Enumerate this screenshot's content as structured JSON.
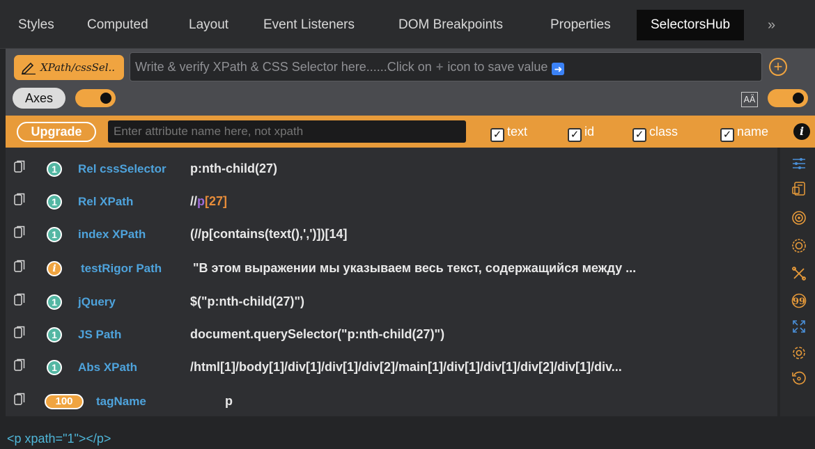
{
  "tabs": [
    {
      "label": "Styles",
      "active": false
    },
    {
      "label": "Computed",
      "active": false
    },
    {
      "label": "Layout",
      "active": false
    },
    {
      "label": "Event Listeners",
      "active": false
    },
    {
      "label": "DOM Breakpoints",
      "active": false
    },
    {
      "label": "Properties",
      "active": false
    },
    {
      "label": "SelectorsHub",
      "active": true
    }
  ],
  "tab_more": "»",
  "toolbar": {
    "xpath_button_label": "XPath/cssSel..",
    "selector_placeholder_before": "Write & verify XPath & CSS Selector here......Click on",
    "selector_placeholder_after": "icon to save value",
    "plus_glyph": "+",
    "add_glyph": "+",
    "axes_label": "Axes",
    "axes_toggle_on": true,
    "font_icon_text": "AÄ",
    "right_toggle_on": true
  },
  "attributes": {
    "upgrade_label": "Upgrade",
    "input_placeholder": "Enter attribute name here, not xpath",
    "checkboxes": [
      {
        "label": "text",
        "checked": true
      },
      {
        "label": "id",
        "checked": true
      },
      {
        "label": "class",
        "checked": true
      },
      {
        "label": "name",
        "checked": true
      }
    ],
    "check_glyph": "✓",
    "info_glyph": "i"
  },
  "results": [
    {
      "badge": "1",
      "badge_type": "count",
      "label": "Rel cssSelector",
      "value": "p:nth-child(27)"
    },
    {
      "badge": "1",
      "badge_type": "count",
      "label": "Rel XPath",
      "value_parts": [
        "//",
        "p",
        "[27]"
      ]
    },
    {
      "badge": "1",
      "badge_type": "count",
      "label": "index XPath",
      "value": "(//p[contains(text(),',')])[14]"
    },
    {
      "badge": "i",
      "badge_type": "info",
      "label": "testRigor Path",
      "value": "\"В этом выражении мы указываем весь текст, содержащийся между ..."
    },
    {
      "badge": "1",
      "badge_type": "count",
      "label": "jQuery",
      "value": "$(\"p:nth-child(27)\")"
    },
    {
      "badge": "1",
      "badge_type": "count",
      "label": "JS Path",
      "value": "document.querySelector(\"p:nth-child(27)\")"
    },
    {
      "badge": "1",
      "badge_type": "count",
      "label": "Abs XPath",
      "value": "/html[1]/body[1]/div[1]/div[1]/div[2]/main[1]/div[1]/div[1]/div[2]/div[1]/div..."
    },
    {
      "badge": "100",
      "badge_type": "count-wide",
      "label": "tagName",
      "value": "p"
    }
  ],
  "sidebar_icons": [
    "sliders-icon",
    "snippet-icon",
    "target-icon",
    "gear-target-icon",
    "tools-icon",
    "quote-icon",
    "expand-icon",
    "settings-icon",
    "reset-icon"
  ],
  "outer_html": "<p xpath=\"1\"></p>",
  "colors": {
    "accent": "#f0a440",
    "label_blue": "#4ea3dc",
    "badge_teal": "#54b7a3"
  }
}
